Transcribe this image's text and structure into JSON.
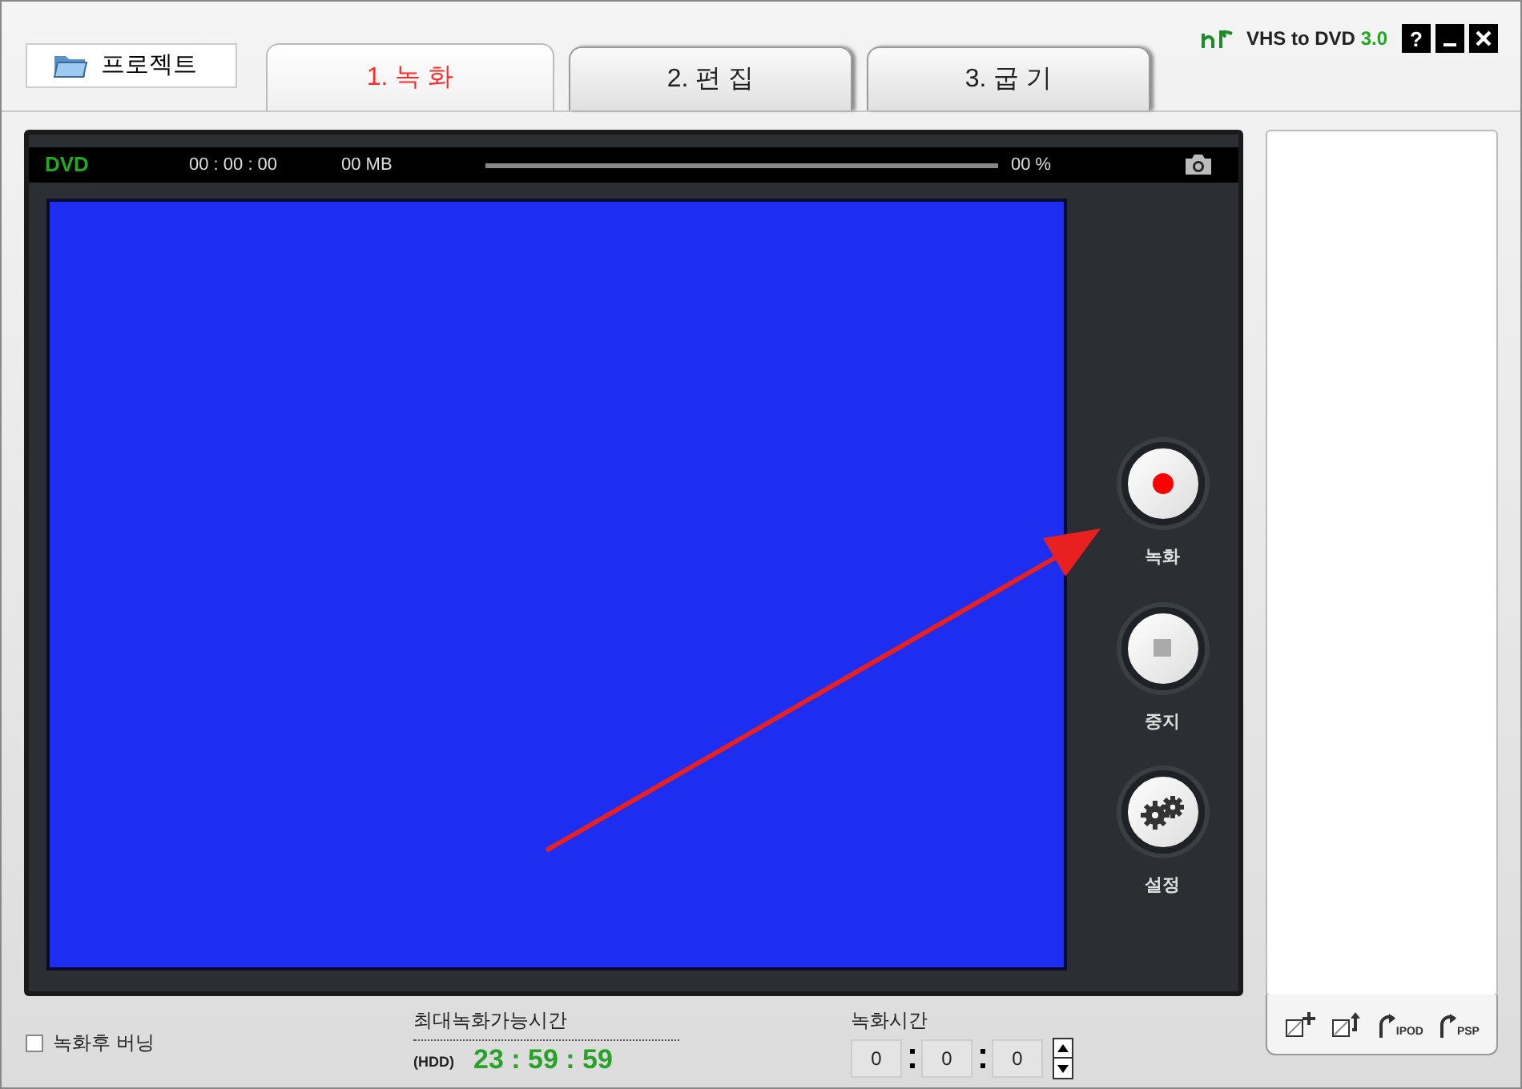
{
  "project_button": "프로젝트",
  "app_title": {
    "name": "VHS to DVD",
    "version": "3.0"
  },
  "help_button": "?",
  "tabs": [
    {
      "label": "1. 녹 화",
      "selected": true
    },
    {
      "label": "2. 편 집",
      "selected": false
    },
    {
      "label": "3. 굽 기",
      "selected": false
    }
  ],
  "recorder": {
    "disc": "DVD",
    "elapsed": "00 : 00 : 00",
    "size": "00 MB",
    "level": 0,
    "percent": "00 %"
  },
  "controls": [
    {
      "kind": "record",
      "label": "녹화"
    },
    {
      "kind": "stop",
      "label": "중지"
    },
    {
      "kind": "settings",
      "label": "설정"
    }
  ],
  "burn_after_record": {
    "label": "녹화후 버닝",
    "checked": false
  },
  "max_time": {
    "label": "최대녹화가능시간",
    "drive": "(HDD)",
    "value": "23 : 59 : 59"
  },
  "record_time": {
    "label": "녹화시간",
    "fields": [
      "0",
      "0",
      "0"
    ]
  },
  "side_tools": [
    {
      "kind": "add"
    },
    {
      "kind": "export"
    },
    {
      "kind": "device",
      "label": "IPOD"
    },
    {
      "kind": "device",
      "label": "PSP"
    }
  ]
}
